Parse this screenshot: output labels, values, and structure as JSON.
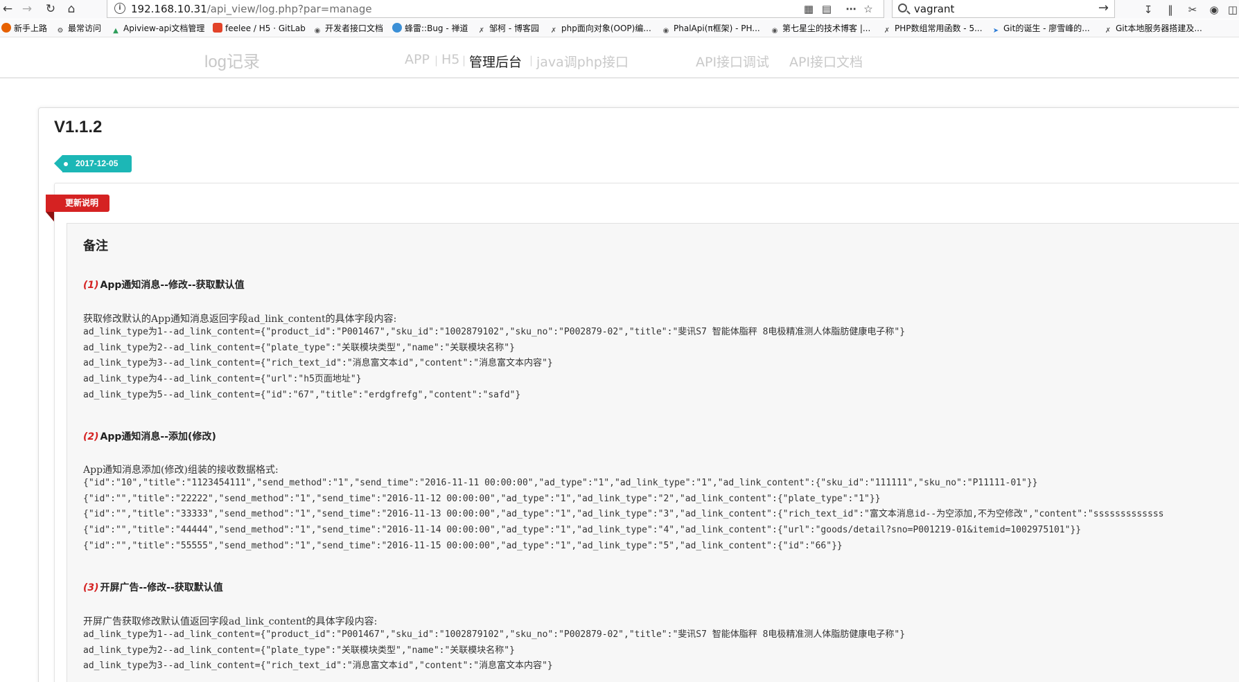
{
  "browser": {
    "url_host": "192.168.10.31",
    "url_path": "/api_view/log.php?par=manage",
    "search_value": "vagrant",
    "bookmarks": [
      "新手上路",
      "最常访问",
      "Apiview-api文档管理",
      "feelee / H5 · GitLab",
      "开发者接口文档",
      "蜂雷::Bug - 禅道",
      "邹柯 - 博客园",
      "php面向对象(OOP)编...",
      "PhalApi(π框架) - PH...",
      "第七星尘的技术博客 |...",
      "PHP数组常用函数 - 5...",
      "Git的诞生 - 廖雪峰的...",
      "Git本地服务器搭建及..."
    ],
    "colors": {
      "toolbar_bg": "#f9f9fa",
      "teal": "#1cb7b6",
      "red": "#d52222"
    },
    "icons": [
      "back-icon",
      "forward-icon",
      "reload-icon",
      "home-icon",
      "info-icon",
      "qr-code-icon",
      "reader-icon",
      "more-icon",
      "bookmark-star-icon",
      "search-icon",
      "arrow-right-icon",
      "download-icon",
      "library-icon",
      "screenshot-icon",
      "chat-icon",
      "sidebar-icon"
    ]
  },
  "header": {
    "brand": "log记录",
    "nav": [
      {
        "label": "APP",
        "active": false
      },
      {
        "label": "H5",
        "active": false
      },
      {
        "label": "管理后台",
        "active": true
      },
      {
        "label": "java调php接口",
        "active": false
      },
      {
        "label": "API接口调试",
        "active": false
      },
      {
        "label": "API接口文档",
        "active": false
      }
    ],
    "separator": "|"
  },
  "log": {
    "version": "V1.1.2",
    "date": "2017-12-05",
    "ribbon": "更新说明",
    "notes_title": "备注",
    "sections": [
      {
        "num": "(1)",
        "title": "App通知消息--修改--获取默认值",
        "intro": "获取修改默认的App通知消息返回字段ad_link_content的具体字段内容:",
        "lines": [
          "ad_link_type为1--ad_link_content={\"product_id\":\"P001467\",\"sku_id\":\"1002879102\",\"sku_no\":\"P002879-02\",\"title\":\"斐讯S7 智能体脂秤 8电极精准测人体脂肪健康电子称\"}",
          "ad_link_type为2--ad_link_content={\"plate_type\":\"关联模块类型\",\"name\":\"关联模块名称\"}",
          "ad_link_type为3--ad_link_content={\"rich_text_id\":\"消息富文本id\",\"content\":\"消息富文本内容\"}",
          "ad_link_type为4--ad_link_content={\"url\":\"h5页面地址\"}",
          "ad_link_type为5--ad_link_content={\"id\":\"67\",\"title\":\"erdgfrefg\",\"content\":\"safd\"}"
        ]
      },
      {
        "num": "(2)",
        "title": "App通知消息--添加(修改)",
        "intro": "App通知消息添加(修改)组装的接收数据格式:",
        "lines": [
          "{\"id\":\"10\",\"title\":\"1123454111\",\"send_method\":\"1\",\"send_time\":\"2016-11-11 00:00:00\",\"ad_type\":\"1\",\"ad_link_type\":\"1\",\"ad_link_content\":{\"sku_id\":\"111111\",\"sku_no\":\"P11111-01\"}}",
          "{\"id\":\"\",\"title\":\"22222\",\"send_method\":\"1\",\"send_time\":\"2016-11-12 00:00:00\",\"ad_type\":\"1\",\"ad_link_type\":\"2\",\"ad_link_content\":{\"plate_type\":\"1\"}}",
          "{\"id\":\"\",\"title\":\"33333\",\"send_method\":\"1\",\"send_time\":\"2016-11-13 00:00:00\",\"ad_type\":\"1\",\"ad_link_type\":\"3\",\"ad_link_content\":{\"rich_text_id\":\"富文本消息id--为空添加,不为空修改\",\"content\":\"sssssssssssss",
          "{\"id\":\"\",\"title\":\"44444\",\"send_method\":\"1\",\"send_time\":\"2016-11-14 00:00:00\",\"ad_type\":\"1\",\"ad_link_type\":\"4\",\"ad_link_content\":{\"url\":\"goods/detail?sno=P001219-01&itemid=1002975101\"}}",
          "{\"id\":\"\",\"title\":\"55555\",\"send_method\":\"1\",\"send_time\":\"2016-11-15 00:00:00\",\"ad_type\":\"1\",\"ad_link_type\":\"5\",\"ad_link_content\":{\"id\":\"66\"}}"
        ]
      },
      {
        "num": "(3)",
        "title": "开屏广告--修改--获取默认值",
        "intro": "开屏广告获取修改默认值返回字段ad_link_content的具体字段内容:",
        "lines": [
          "ad_link_type为1--ad_link_content={\"product_id\":\"P001467\",\"sku_id\":\"1002879102\",\"sku_no\":\"P002879-02\",\"title\":\"斐讯S7 智能体脂秤 8电极精准测人体脂肪健康电子称\"}",
          "ad_link_type为2--ad_link_content={\"plate_type\":\"关联模块类型\",\"name\":\"关联模块名称\"}",
          "ad_link_type为3--ad_link_content={\"rich_text_id\":\"消息富文本id\",\"content\":\"消息富文本内容\"}"
        ]
      }
    ]
  }
}
